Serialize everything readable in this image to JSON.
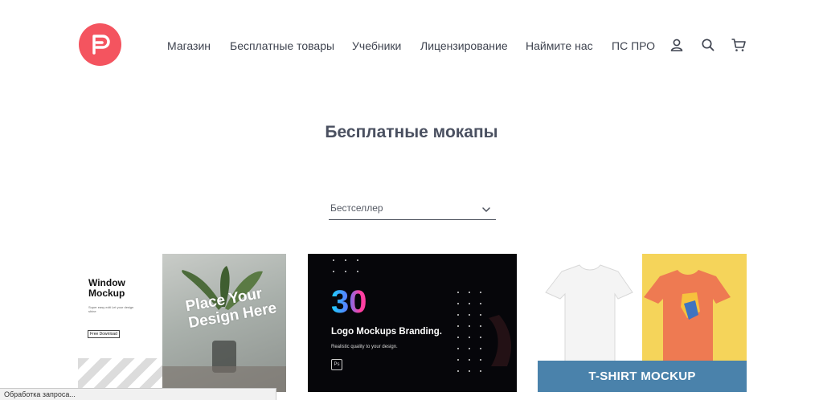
{
  "header": {
    "logo_icon": "brand-p-logo",
    "brand_color": "#f4545f",
    "nav": [
      {
        "label": "Магазин"
      },
      {
        "label": "Бесплатные товары"
      },
      {
        "label": "Учебники"
      },
      {
        "label": "Лицензирование"
      },
      {
        "label": "Наймите нас"
      },
      {
        "label": "ПС ПРО"
      }
    ],
    "icons": [
      "user-icon",
      "search-icon",
      "cart-icon"
    ]
  },
  "page": {
    "title": "Бесплатные мокапы",
    "sort": {
      "selected": "Бестселлер",
      "icon": "chevron-down-icon"
    }
  },
  "products": [
    {
      "title": "Window Mockup",
      "small_text": "Super easy edit\nLet your design shine",
      "button": "Free Download",
      "overlay": "Place Your Design Here"
    },
    {
      "number": "30",
      "title": "Logo Mockups Branding.",
      "subtitle": "Realistic quality to your design.",
      "badge": "Ps"
    },
    {
      "banner": "T-SHIRT MOCKUP"
    }
  ],
  "status": {
    "text": "Обработка запроса..."
  }
}
